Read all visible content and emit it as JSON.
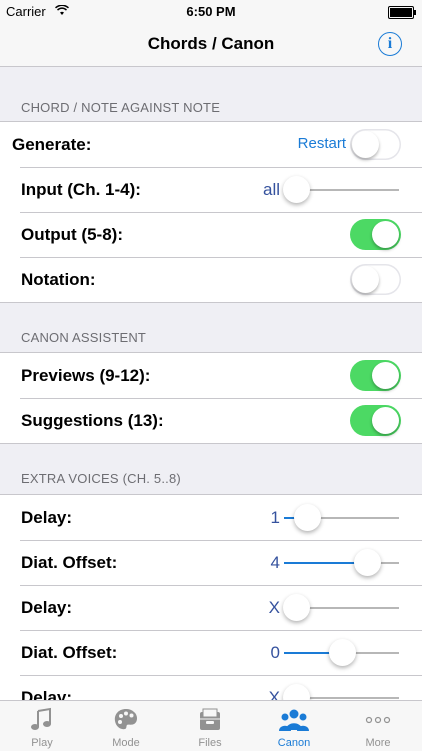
{
  "status_bar": {
    "carrier": "Carrier",
    "time": "6:50 PM"
  },
  "nav": {
    "title": "Chords / Canon",
    "info_icon": "info-icon"
  },
  "sections": [
    {
      "header": "CHORD / NOTE AGAINST NOTE",
      "rows": [
        {
          "label": "Generate:",
          "link": "Restart",
          "toggle": false
        },
        {
          "label": "Input (Ch. 1-4):",
          "value": "all",
          "level": 0.1
        },
        {
          "label": "Output (5-8):",
          "toggle": true
        },
        {
          "label": "Notation:",
          "toggle": false
        }
      ]
    },
    {
      "header": "CANON ASSISTENT",
      "rows": [
        {
          "label": "Previews (9-12):",
          "toggle": true
        },
        {
          "label": "Suggestions (13):",
          "toggle": true
        }
      ]
    },
    {
      "header": "EXTRA VOICES (CH. 5..8)",
      "rows": [
        {
          "label": "Delay:",
          "value": "1",
          "level": 0.2
        },
        {
          "label": "Diat. Offset:",
          "value": "4",
          "level": 0.72
        },
        {
          "label": "Delay:",
          "value": "X",
          "level": 0.1
        },
        {
          "label": "Diat. Offset:",
          "value": "0",
          "level": 0.5
        },
        {
          "label": "Delay:",
          "value": "X",
          "level": 0.1
        }
      ]
    }
  ],
  "tabs": [
    {
      "label": "Play",
      "icon": "music-note-icon",
      "active": false
    },
    {
      "label": "Mode",
      "icon": "palette-icon",
      "active": false
    },
    {
      "label": "Files",
      "icon": "file-tray-icon",
      "active": false
    },
    {
      "label": "Canon",
      "icon": "group-icon",
      "active": true
    },
    {
      "label": "More",
      "icon": "more-dots-icon",
      "active": false
    }
  ],
  "colors": {
    "accent": "#1a7bd6",
    "toggle_on": "#4cd964",
    "value_text": "#35529e"
  }
}
